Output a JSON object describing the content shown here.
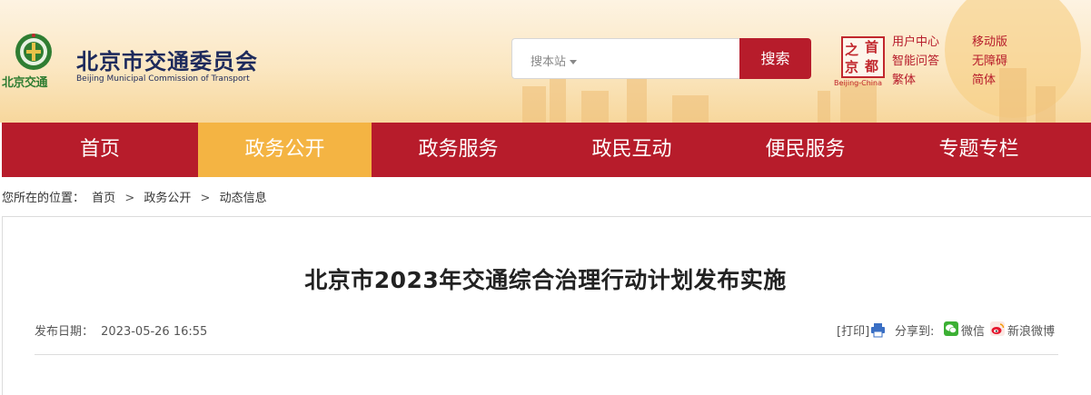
{
  "header": {
    "logo_text": "北京交通",
    "site_title": "北京市交通委员会",
    "site_subtitle": "Beijing Municipal Commission of Transport",
    "search": {
      "placeholder": "搜本站",
      "button_label": "搜索"
    },
    "seal": {
      "chars": [
        "之",
        "首",
        "京",
        "都"
      ],
      "caption": "Beijing-China"
    },
    "util_links": [
      "用户中心",
      "移动版",
      "智能问答",
      "无障碍",
      "繁体",
      "简体"
    ]
  },
  "nav": {
    "items": [
      {
        "label": "首页"
      },
      {
        "label": "政务公开"
      },
      {
        "label": "政务服务"
      },
      {
        "label": "政民互动"
      },
      {
        "label": "便民服务"
      },
      {
        "label": "专题专栏"
      }
    ],
    "active_index": 1
  },
  "breadcrumb": {
    "prefix": "您所在的位置：",
    "items": [
      "首页",
      "政务公开",
      "动态信息"
    ],
    "separator": ">"
  },
  "article": {
    "title": "北京市2023年交通综合治理行动计划发布实施",
    "date_label": "发布日期：",
    "date_value": "2023-05-26 16:55",
    "print_label": "[打印]",
    "share_label": "分享到:",
    "share_wechat": "微信",
    "share_weibo": "新浪微博"
  },
  "colors": {
    "primary_red": "#b71c2b",
    "active_tab": "#f4b443",
    "title_blue": "#1d2a5c"
  }
}
